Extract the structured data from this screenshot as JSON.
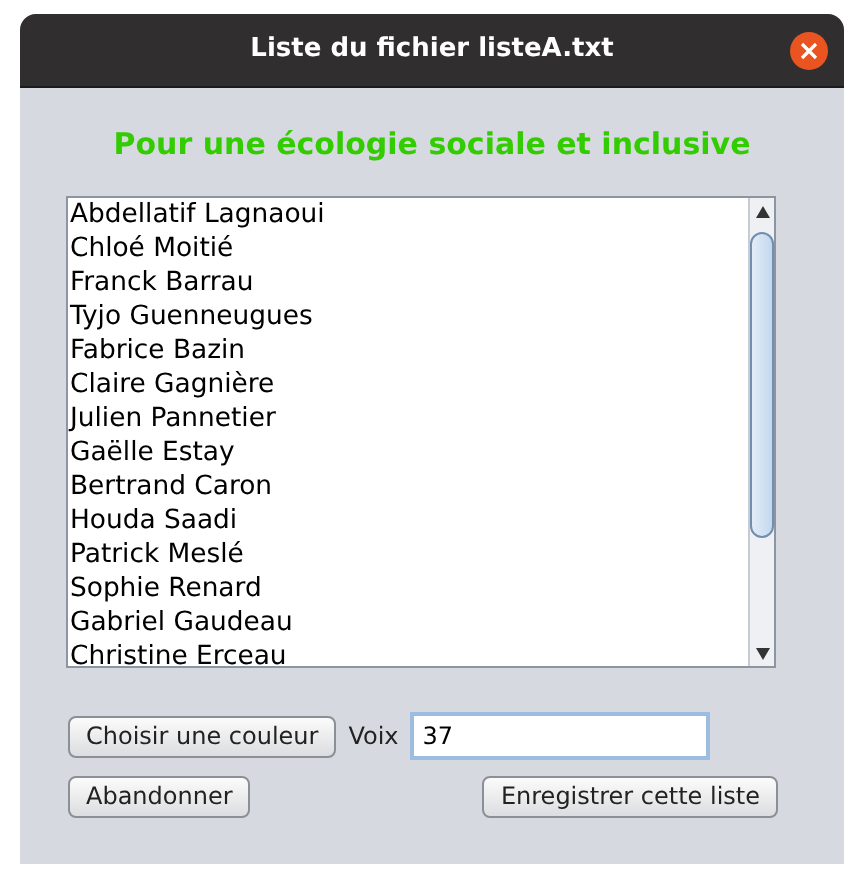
{
  "window": {
    "title": "Liste du fichier listeA.txt"
  },
  "heading": "Pour une écologie sociale et inclusive",
  "names": [
    "Abdellatif Lagnaoui",
    "Chloé Moitié",
    "Franck Barrau",
    "Tyjo Guenneugues",
    "Fabrice Bazin",
    "Claire Gagnière",
    "Julien Pannetier",
    "Gaëlle Estay",
    "Bertrand Caron",
    "Houda Saadi",
    "Patrick Meslé",
    "Sophie Renard",
    "Gabriel Gaudeau",
    "Christine Erceau"
  ],
  "color_button": "Choisir une couleur",
  "votes": {
    "label": "Voix",
    "value": "37"
  },
  "buttons": {
    "cancel": "Abandonner",
    "save": "Enregistrer cette liste"
  }
}
